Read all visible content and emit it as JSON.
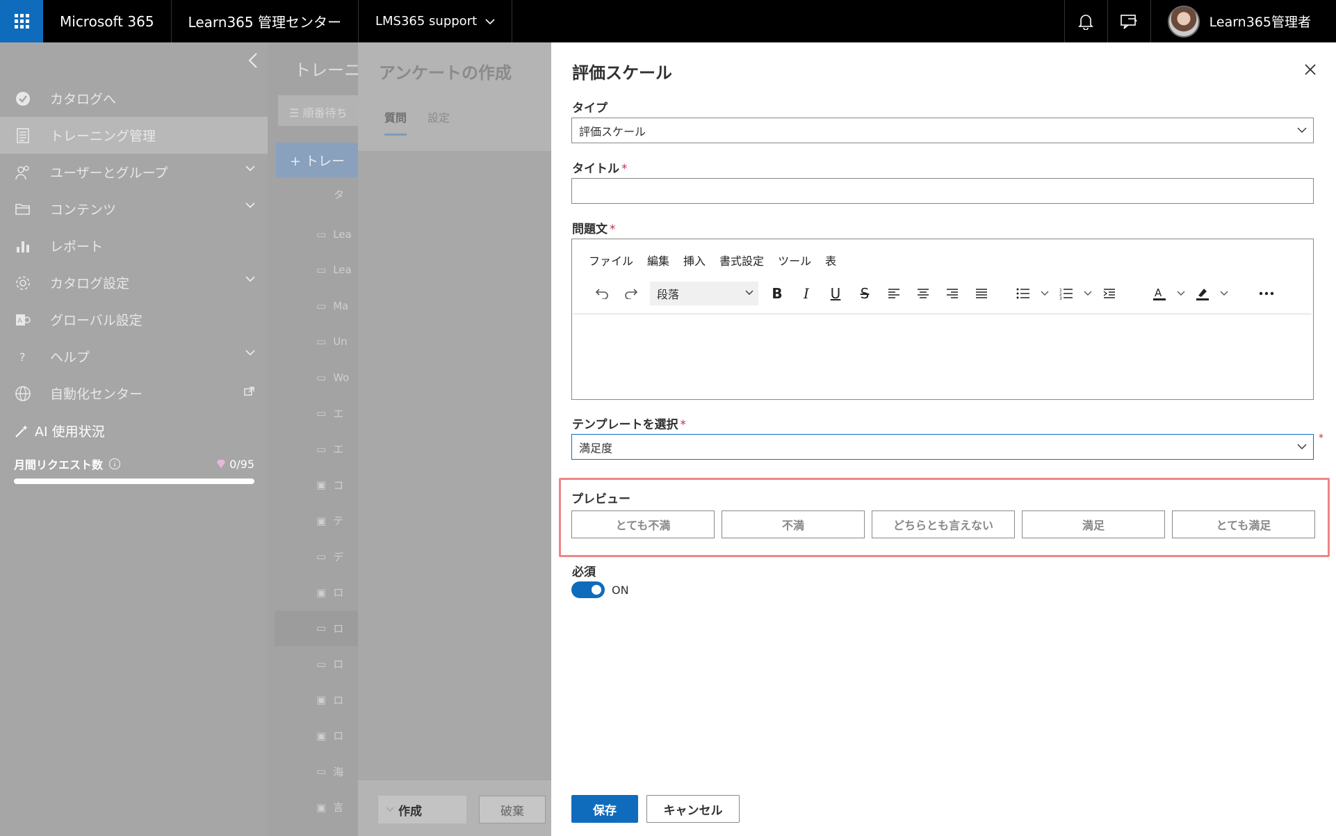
{
  "topbar": {
    "brand": "Microsoft 365",
    "app_title": "Learn365 管理センター",
    "org": "LMS365 support",
    "user_name": "Learn365管理者"
  },
  "leftnav": {
    "items": [
      {
        "label": "カタログへ",
        "icon": "check-circle-icon",
        "chevron": false
      },
      {
        "label": "トレーニング管理",
        "icon": "document-icon",
        "chevron": false
      },
      {
        "label": "ユーザーとグループ",
        "icon": "people-icon",
        "chevron": true
      },
      {
        "label": "コンテンツ",
        "icon": "folder-icon",
        "chevron": true
      },
      {
        "label": "レポート",
        "icon": "bar-chart-icon",
        "chevron": false
      },
      {
        "label": "カタログ設定",
        "icon": "gear-icon",
        "chevron": true
      },
      {
        "label": "グローバル設定",
        "icon": "global-settings-icon",
        "chevron": false
      },
      {
        "label": "ヘルプ",
        "icon": "question-icon",
        "chevron": true
      },
      {
        "label": "自動化センター",
        "icon": "globe-icon",
        "chevron": false
      }
    ],
    "ai_title": "AI 使用状況",
    "monthly_requests_label": "月間リクエスト数",
    "monthly_requests_value": "0/95"
  },
  "midcontent": {
    "title": "トレーニ",
    "search_text": "順番待ち",
    "new_button": "+ トレー",
    "header_text": "タ",
    "rows": [
      "Lea",
      "Lea",
      "Ma",
      "Un",
      "Wo",
      "エ",
      "エ",
      "コ",
      "テ",
      "デ",
      "ロ",
      "ロ",
      "ロ",
      "ロ",
      "ロ",
      "海",
      "言"
    ]
  },
  "survey": {
    "title": "アンケートの作成",
    "tabs": [
      "質問",
      "設定"
    ],
    "create_button": "作成",
    "discard_button": "破棄"
  },
  "panel": {
    "title": "評価スケール",
    "type_label": "タイプ",
    "type_value": "評価スケール",
    "title_label": "タイトル",
    "question_label": "問題文",
    "editor_menu": [
      "ファイル",
      "編集",
      "挿入",
      "書式設定",
      "ツール",
      "表"
    ],
    "paragraph_select": "段落",
    "template_label": "テンプレートを選択",
    "template_value": "満足度",
    "preview_label": "プレビュー",
    "preview_options": [
      "とても不満",
      "不満",
      "どちらとも言えない",
      "満足",
      "とても満足"
    ],
    "required_label": "必須",
    "required_state": "ON",
    "save_button": "保存",
    "cancel_button": "キャンセル"
  },
  "colors": {
    "accent": "#0f6cbd",
    "preview_highlight": "#ee8585",
    "required_star": "#c4314b"
  }
}
